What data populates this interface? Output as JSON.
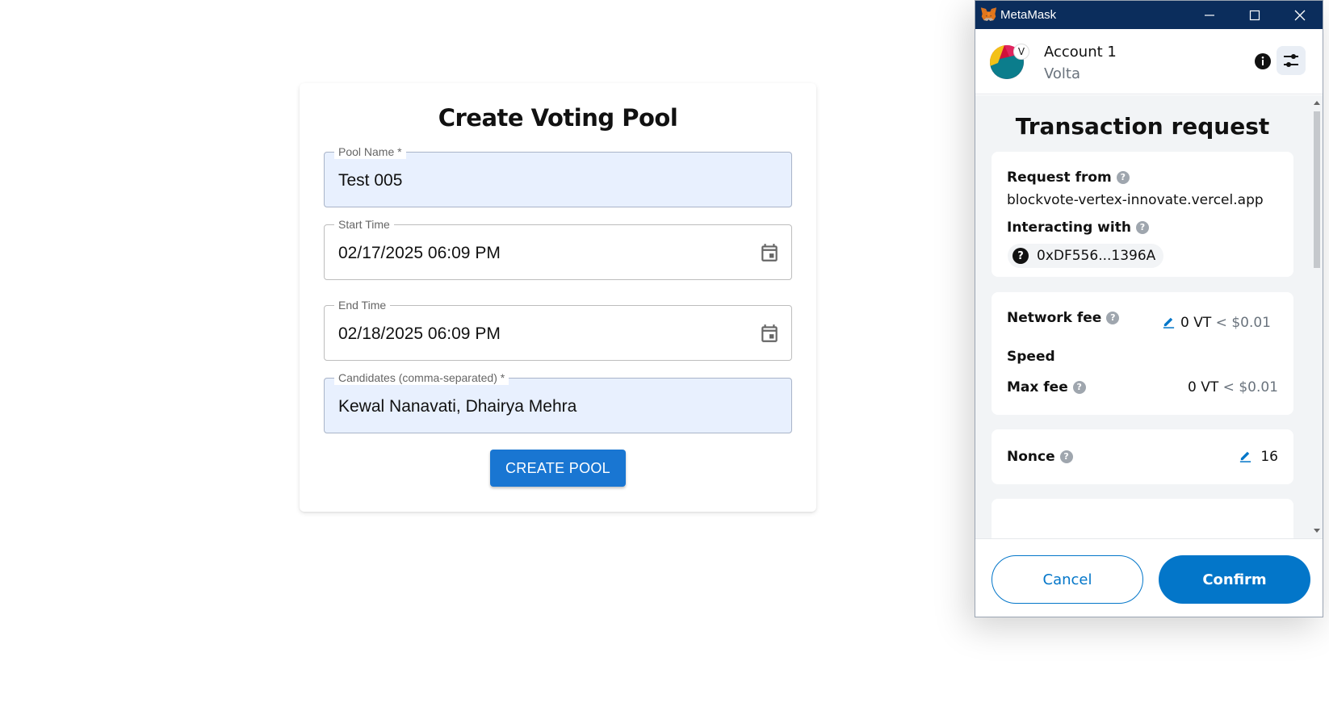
{
  "form": {
    "title": "Create Voting Pool",
    "pool_name": {
      "label": "Pool Name *",
      "value": "Test 005"
    },
    "start_time": {
      "label": "Start Time",
      "value": "02/17/2025 06:09 PM"
    },
    "end_time": {
      "label": "End Time",
      "value": "02/18/2025 06:09 PM"
    },
    "candidates": {
      "label": "Candidates (comma-separated) *",
      "value": "Kewal Nanavati, Dhairya Mehra"
    },
    "submit_label": "CREATE POOL"
  },
  "metamask": {
    "window_title": "MetaMask",
    "account": {
      "name": "Account 1",
      "network": "Volta",
      "network_badge": "V"
    },
    "title": "Transaction request",
    "request_from": {
      "label": "Request from",
      "value": "blockvote-vertex-innovate.vercel.app"
    },
    "interacting_with": {
      "label": "Interacting with",
      "value": "0xDF556...1396A",
      "icon_glyph": "?"
    },
    "fees": {
      "network_fee_label": "Network fee",
      "network_fee_value": "0 VT",
      "network_fee_fiat": "< $0.01",
      "speed_label": "Speed",
      "max_fee_label": "Max fee",
      "max_fee_value": "0 VT",
      "max_fee_fiat": "< $0.01"
    },
    "nonce": {
      "label": "Nonce",
      "value": "16"
    },
    "buttons": {
      "cancel": "Cancel",
      "confirm": "Confirm"
    }
  },
  "colors": {
    "primary_button": "#1976d2",
    "filled_field_bg": "#e8f0fe",
    "metamask_titlebar": "#0b2d5c",
    "metamask_accent": "#0376c9"
  },
  "icons": [
    "calendar-icon",
    "metamask-fox-icon",
    "minimize-icon",
    "maximize-icon",
    "close-icon",
    "info-icon",
    "settings-sliders-icon",
    "help-icon",
    "edit-pencil-icon",
    "unknown-contract-icon"
  ]
}
